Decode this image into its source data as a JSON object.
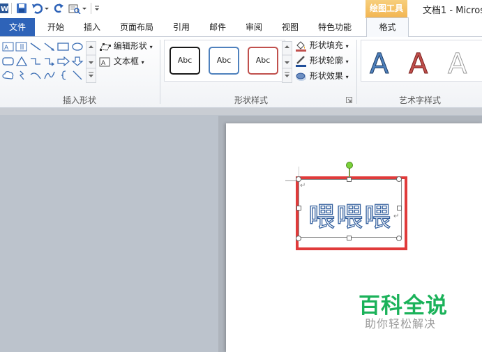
{
  "app": {
    "context_tab_title": "绘图工具",
    "doc_title": "文档1 - Micros"
  },
  "tabs": [
    {
      "label": "文件"
    },
    {
      "label": "开始"
    },
    {
      "label": "插入"
    },
    {
      "label": "页面布局"
    },
    {
      "label": "引用"
    },
    {
      "label": "邮件"
    },
    {
      "label": "审阅"
    },
    {
      "label": "视图"
    },
    {
      "label": "特色功能"
    },
    {
      "label": "格式"
    }
  ],
  "ribbon": {
    "insert_shapes": {
      "label": "插入形状",
      "edit_shape": "编辑形状",
      "text_box": "文本框"
    },
    "shape_styles": {
      "label": "形状样式",
      "presets": [
        {
          "text": "Abc",
          "border": "#1a1a1a"
        },
        {
          "text": "Abc",
          "border": "#4f81bd"
        },
        {
          "text": "Abc",
          "border": "#c0504d"
        }
      ],
      "fill": "形状填充",
      "outline": "形状轮廓",
      "effects": "形状效果"
    },
    "wordart_styles": {
      "label": "艺术字样式",
      "presets": [
        {
          "text": "A",
          "color": "#4f81bd"
        },
        {
          "text": "A",
          "color": "#c0504d"
        },
        {
          "text": "A",
          "color": "#ffffff"
        }
      ]
    }
  },
  "document": {
    "textbox_text": "喂喂喂",
    "selection_color": "#e03a3a"
  },
  "watermark": {
    "title": "百科全说",
    "subtitle": "助你轻松解决"
  }
}
